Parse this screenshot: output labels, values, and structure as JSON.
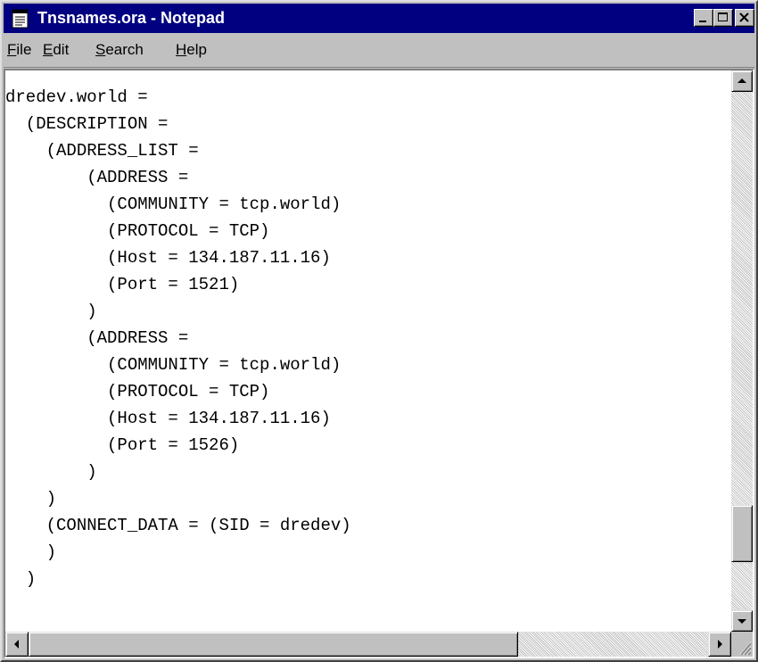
{
  "window": {
    "title": "Tnsnames.ora - Notepad",
    "app_icon": "notepad-icon",
    "controls": [
      "minimize-icon",
      "maximize-icon",
      "close-icon"
    ]
  },
  "menu": {
    "file": {
      "accel": "F",
      "rest": "ile"
    },
    "edit": {
      "accel": "E",
      "rest": "dit"
    },
    "search": {
      "accel": "S",
      "rest": "earch"
    },
    "help": {
      "accel": "H",
      "rest": "elp"
    }
  },
  "editor": {
    "lines": [
      "dredev.world =",
      "  (DESCRIPTION =",
      "    (ADDRESS_LIST =",
      "        (ADDRESS =",
      "          (COMMUNITY = tcp.world)",
      "          (PROTOCOL = TCP)",
      "          (Host = 134.187.11.16)",
      "          (Port = 1521)",
      "        )",
      "        (ADDRESS =",
      "          (COMMUNITY = tcp.world)",
      "          (PROTOCOL = TCP)",
      "          (Host = 134.187.11.16)",
      "          (Port = 1526)",
      "        )",
      "    )",
      "    (CONNECT_DATA = (SID = dredev)",
      "    )",
      "  )"
    ]
  },
  "scrollbars": {
    "vertical_position": 0.88,
    "horizontal_position": 0.0
  },
  "colors": {
    "titlebar": "#000080",
    "chrome": "#c0c0c0",
    "editor_bg": "#ffffff"
  }
}
